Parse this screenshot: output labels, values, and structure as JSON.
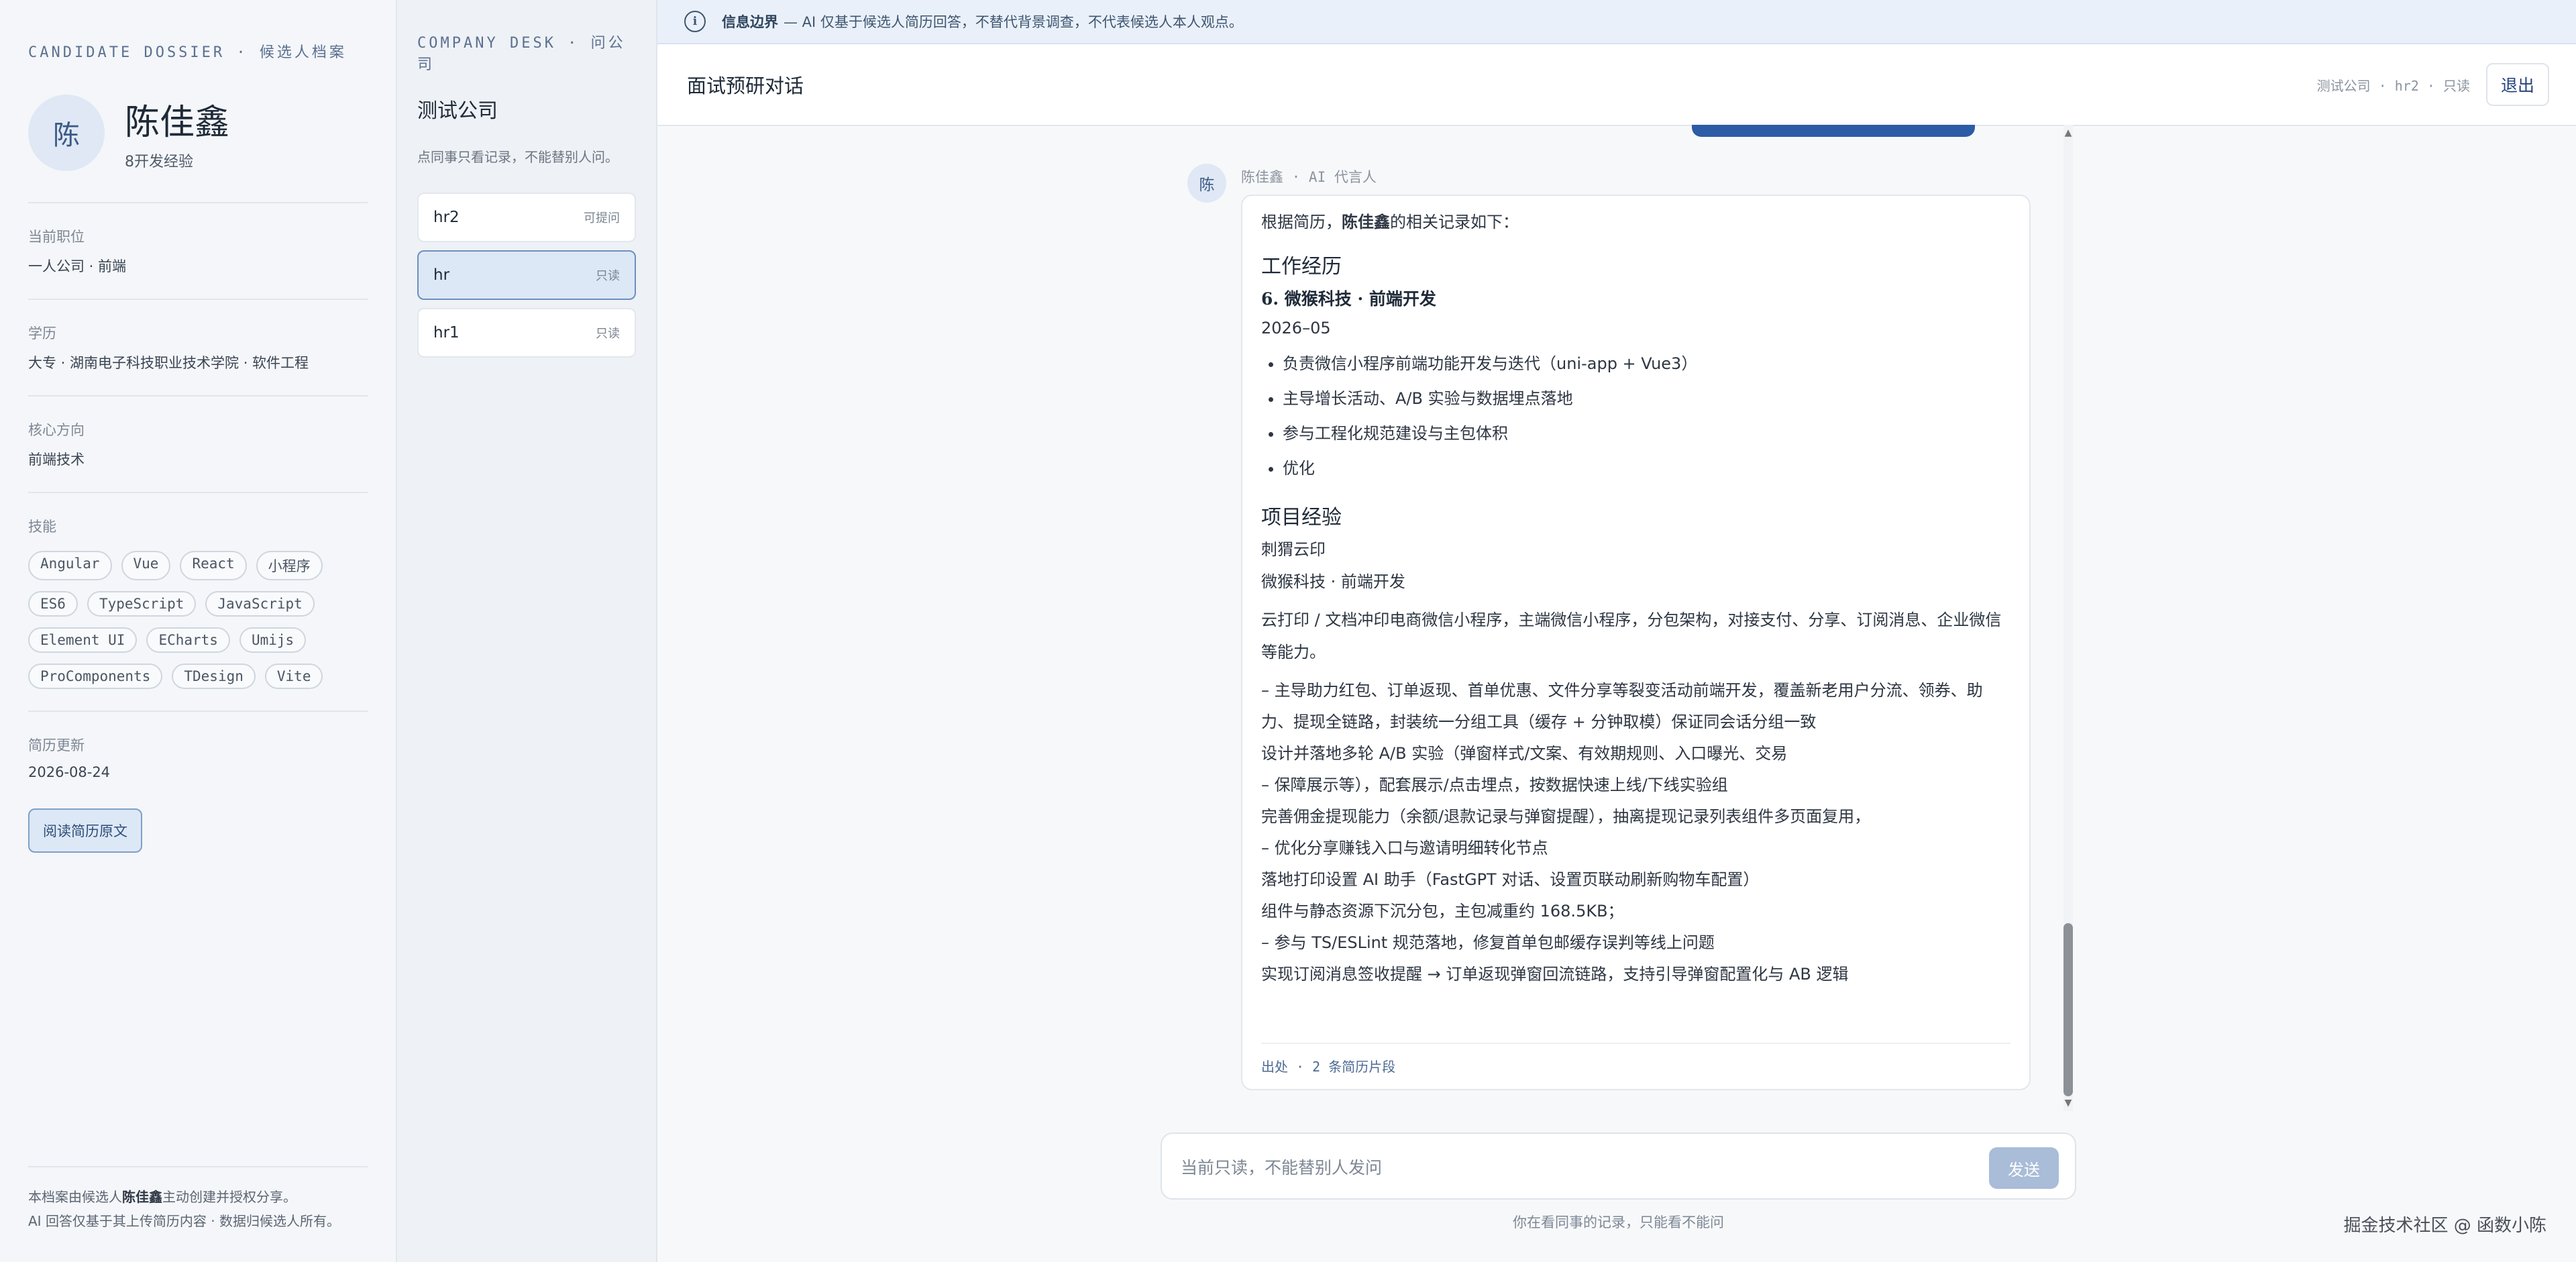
{
  "dossier": {
    "eyebrow": "CANDIDATE DOSSIER · 候选人档案",
    "avatar_char": "陈",
    "name": "陈佳鑫",
    "experience": "8开发经验",
    "fields": [
      {
        "label": "当前职位",
        "value": "一人公司 · 前端"
      },
      {
        "label": "学历",
        "value": "大专 · 湖南电子科技职业技术学院 · 软件工程"
      },
      {
        "label": "核心方向",
        "value": "前端技术"
      }
    ],
    "skills_label": "技能",
    "skills": [
      "Angular",
      "Vue",
      "React",
      "小程序",
      "ES6",
      "TypeScript",
      "JavaScript",
      "Element UI",
      "ECharts",
      "Umijs",
      "ProComponents",
      "TDesign",
      "Vite"
    ],
    "updated_label": "简历更新",
    "updated_value": "2026-08-24",
    "resume_button": "阅读简历原文",
    "footer_line1_a": "本档案由候选人",
    "footer_line1_name": "陈佳鑫",
    "footer_line1_b": "主动创建并授权分享。",
    "footer_line2": "AI 回答仅基于其上传简历内容 · 数据归候选人所有。"
  },
  "desk": {
    "eyebrow": "COMPANY DESK · 问公司",
    "title": "测试公司",
    "hint": "点同事只看记录，不能替别人问。",
    "items": [
      {
        "name": "hr2",
        "tag": "可提问"
      },
      {
        "name": "hr",
        "tag": "只读"
      },
      {
        "name": "hr1",
        "tag": "只读"
      }
    ]
  },
  "notice": {
    "label": "信息边界",
    "text": "— AI 仅基于候选人简历回答，不替代背景调查，不代表候选人本人观点。"
  },
  "topbar": {
    "title": "面试预研对话",
    "meta": "测试公司 · hr2 · 只读",
    "logout": "退出"
  },
  "message": {
    "avatar_char": "陈",
    "sender": "陈佳鑫 · AI 代言人",
    "intro_a": "根据简历，",
    "intro_name": "陈佳鑫",
    "intro_b": "的相关记录如下：",
    "work_heading": "工作经历",
    "job_title": "6. 微猴科技 · 前端开发",
    "job_date": "2026–05",
    "bullets": [
      "负责微信小程序前端功能开发与迭代（uni-app + Vue3）",
      "主导增长活动、A/B 实验与数据埋点落地",
      "参与工程化规范建设与主包体积",
      "优化"
    ],
    "project_heading": "项目经验",
    "project_name": "刺猬云印",
    "project_company": "微猴科技 · 前端开发",
    "project_desc": "云打印 / 文档冲印电商微信小程序，主端微信小程序，分包架构，对接支付、分享、订阅消息、企业微信等能力。",
    "details": [
      "– 主导助力红包、订单返现、首单优惠、文件分享等裂变活动前端开发，覆盖新老用户分流、领券、助力、提现全链路，封装统一分组工具（缓存 + 分钟取模）保证同会话分组一致",
      "设计并落地多轮 A/B 实验（弹窗样式/文案、有效期规则、入口曝光、交易",
      "– 保障展示等），配套展示/点击埋点，按数据快速上线/下线实验组",
      "完善佣金提现能力（余额/退款记录与弹窗提醒），抽离提现记录列表组件多页面复用，",
      "– 优化分享赚钱入口与邀请明细转化节点",
      "落地打印设置 AI 助手（FastGPT 对话、设置页联动刷新购物车配置）",
      "组件与静态资源下沉分包，主包减重约 168.5KB；",
      "– 参与 TS/ESLint 规范落地，修复首单包邮缓存误判等线上问题",
      "实现订阅消息签收提醒 → 订单返现弹窗回流链路，支持引导弹窗配置化与 AB 逻辑"
    ],
    "source": "出处 · 2 条简历片段"
  },
  "composer": {
    "placeholder": "当前只读，不能替别人发问",
    "send": "发送",
    "hint": "你在看同事的记录，只能看不能问"
  },
  "watermark": "掘金技术社区 @ 函数小陈",
  "colors": {
    "accent": "#2c5ca5",
    "notice_bg": "#e9f0f9",
    "active_item": "#dde8f6",
    "send_disabled": "#a9bcd8"
  }
}
